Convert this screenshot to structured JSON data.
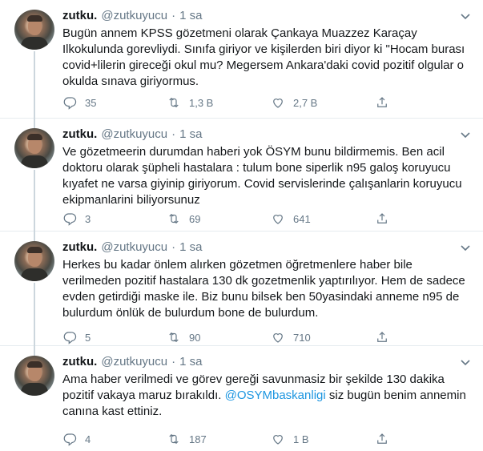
{
  "tweets": [
    {
      "name": "zutku.",
      "handle": "@zutkuyucu",
      "dot": "·",
      "time": "1 sa",
      "text": "Bugün annem KPSS gözetmeni olarak Çankaya Muazzez Karaçay Ilkokulunda gorevliydi. Sınıfa giriyor ve kişilerden biri diyor ki \"Hocam burası covid+lilerin gireceği okul mu? Megersem Ankara'daki covid pozitif olgular o okulda sınava giriyormus.",
      "replies": "35",
      "retweets": "1,3 B",
      "likes": "2,7 B",
      "share": ""
    },
    {
      "name": "zutku.",
      "handle": "@zutkuyucu",
      "dot": "·",
      "time": "1 sa",
      "text": "Ve gözetmeerin durumdan haberi yok ÖSYM bunu bildirmemis. Ben acil doktoru olarak şüpheli hastalara : tulum bone siperlik n95 galoş koruyucu kıyafet ne varsa giyinip giriyorum. Covid servislerinde çalışanlarin koruyucu ekipmanlarini biliyorsunuz",
      "replies": "3",
      "retweets": "69",
      "likes": "641",
      "share": ""
    },
    {
      "name": "zutku.",
      "handle": "@zutkuyucu",
      "dot": "·",
      "time": "1 sa",
      "text": "Herkes bu kadar önlem alırken gözetmen öğretmenlere haber bile verilmeden pozitif hastalara 130 dk gozetmenlik yaptırılıyor. Hem de sadece evden getirdiği maske ile. Biz bunu bilsek ben 50yasindaki anneme n95 de bulurdum önlük de bulurdum bone de bulurdum.",
      "replies": "5",
      "retweets": "90",
      "likes": "710",
      "share": ""
    },
    {
      "name": "zutku.",
      "handle": "@zutkuyucu",
      "dot": "·",
      "time": "1 sa",
      "text_before": "Ama haber verilmedi ve görev gereği savunmasiz bir şekilde 130 dakika pozitif vakaya maruz bırakıldı. ",
      "mention": "@OSYMbaskanligi",
      "text_after": " siz bugün benim annemin canına kast ettiniz.",
      "replies": "4",
      "retweets": "187",
      "likes": "1 B",
      "share": ""
    }
  ],
  "icons": {
    "reply": "reply-icon",
    "retweet": "retweet-icon",
    "like": "heart-icon",
    "share": "share-icon",
    "menu": "chevron-down-icon"
  },
  "colors": {
    "text": "#14171a",
    "secondary": "#657786",
    "link": "#1b95e0",
    "divider": "#e6ecf0",
    "thread": "#ccd6dd"
  }
}
